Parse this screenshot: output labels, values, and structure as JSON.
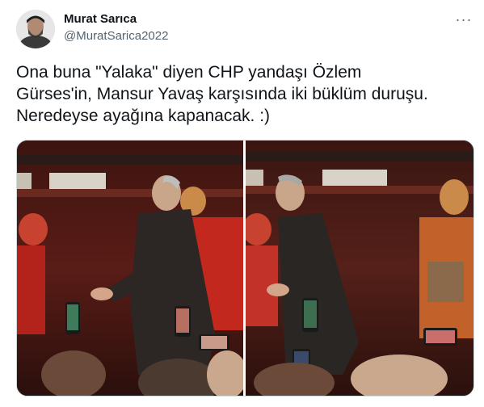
{
  "author": {
    "name": "Murat Sarıca",
    "handle": "@MuratSarica2022"
  },
  "menu": {
    "more_label": "···"
  },
  "tweet": {
    "text": "Ona buna \"Yalaka\" diyen CHP yandaşı Özlem\nGürses'in, Mansur Yavaş karşısında iki büklüm duruşu.\nNeredeyse ayağına kapanacak. :)"
  },
  "colors": {
    "name": "#0f1419",
    "handle": "#536471",
    "border": "#cfd9de",
    "stage_red": "#8b1a16"
  },
  "media": {
    "count": 2,
    "icons": [
      "photo-left",
      "photo-right"
    ]
  }
}
